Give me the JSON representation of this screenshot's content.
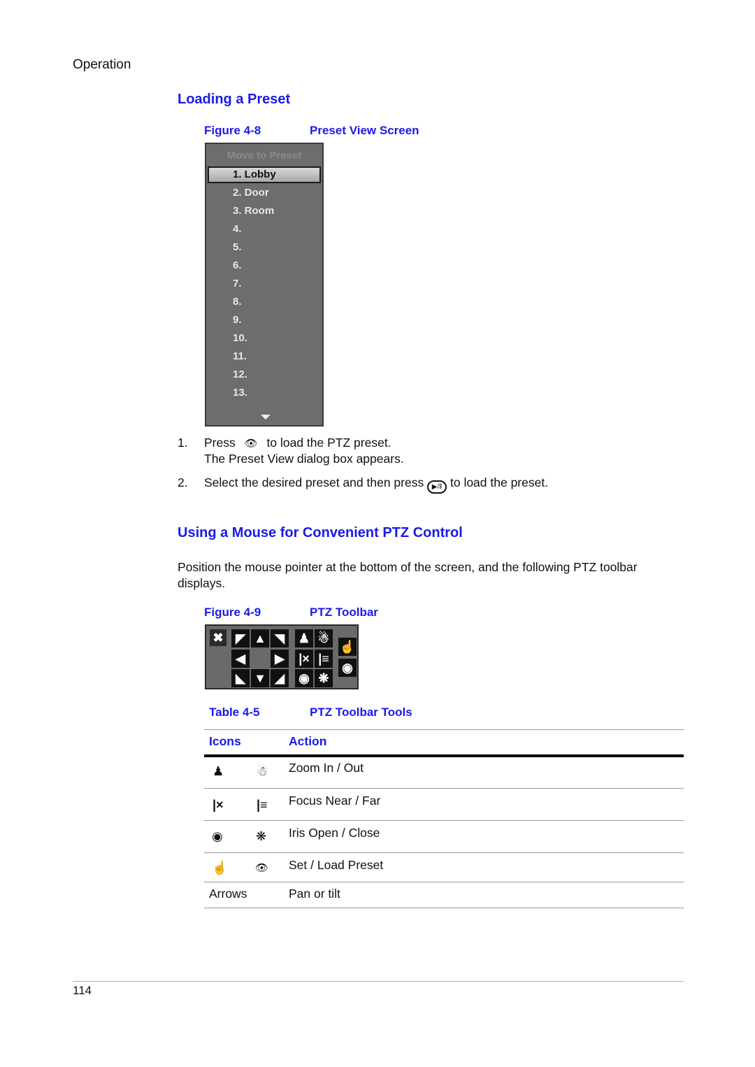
{
  "header": {
    "running_head": "Operation"
  },
  "section1": {
    "title": "Loading a Preset",
    "figure": {
      "number": "Figure 4-8",
      "title": "Preset View Screen"
    },
    "preset_panel": {
      "title": "Move to Preset",
      "items": [
        "1. Lobby",
        "2. Door",
        "3. Room",
        "4.",
        "5.",
        "6.",
        "7.",
        "8.",
        "9.",
        "10.",
        "11.",
        "12.",
        "13."
      ],
      "selected_index": 0,
      "scroll_icon": "triangle-down-icon"
    },
    "steps": [
      {
        "num": "1.",
        "pre": "Press",
        "icon": "eye-icon",
        "post": "to load the PTZ preset.",
        "sub": "The Preset View dialog box appears."
      },
      {
        "num": "2.",
        "pre": "Select the desired preset and then press",
        "icon": "play-pause-icon",
        "post": "to load the preset."
      }
    ]
  },
  "section2": {
    "title": "Using a Mouse for Convenient PTZ Control",
    "intro": "Position the mouse pointer at the bottom of the screen, and the following PTZ toolbar displays.",
    "figure": {
      "number": "Figure 4-9",
      "title": "PTZ Toolbar"
    },
    "toolbar_icons": [
      "close-icon",
      "arrow-up-left-icon",
      "arrow-up-icon",
      "arrow-up-right-icon",
      "arrow-left-icon",
      "arrow-right-icon",
      "arrow-down-left-icon",
      "arrow-down-icon",
      "arrow-down-right-icon",
      "zoom-in-icon",
      "zoom-out-icon",
      "focus-near-icon",
      "focus-far-icon",
      "iris-open-icon",
      "iris-close-icon",
      "set-preset-icon",
      "load-preset-icon"
    ],
    "table": {
      "number": "Table 4-5",
      "title": "PTZ Toolbar Tools",
      "headers": [
        "Icons",
        "Action"
      ],
      "rows": [
        {
          "icons": [
            "zoom-in-icon",
            "zoom-out-icon"
          ],
          "action": "Zoom In / Out"
        },
        {
          "icons": [
            "focus-near-icon",
            "focus-far-icon"
          ],
          "action": "Focus Near / Far"
        },
        {
          "icons": [
            "iris-open-icon",
            "iris-close-icon"
          ],
          "action": "Iris Open / Close"
        },
        {
          "icons": [
            "set-preset-icon",
            "load-preset-icon"
          ],
          "action": "Set / Load Preset"
        },
        {
          "icons_text": "Arrows",
          "action": "Pan or tilt"
        }
      ]
    }
  },
  "footer": {
    "page_number": "114"
  }
}
